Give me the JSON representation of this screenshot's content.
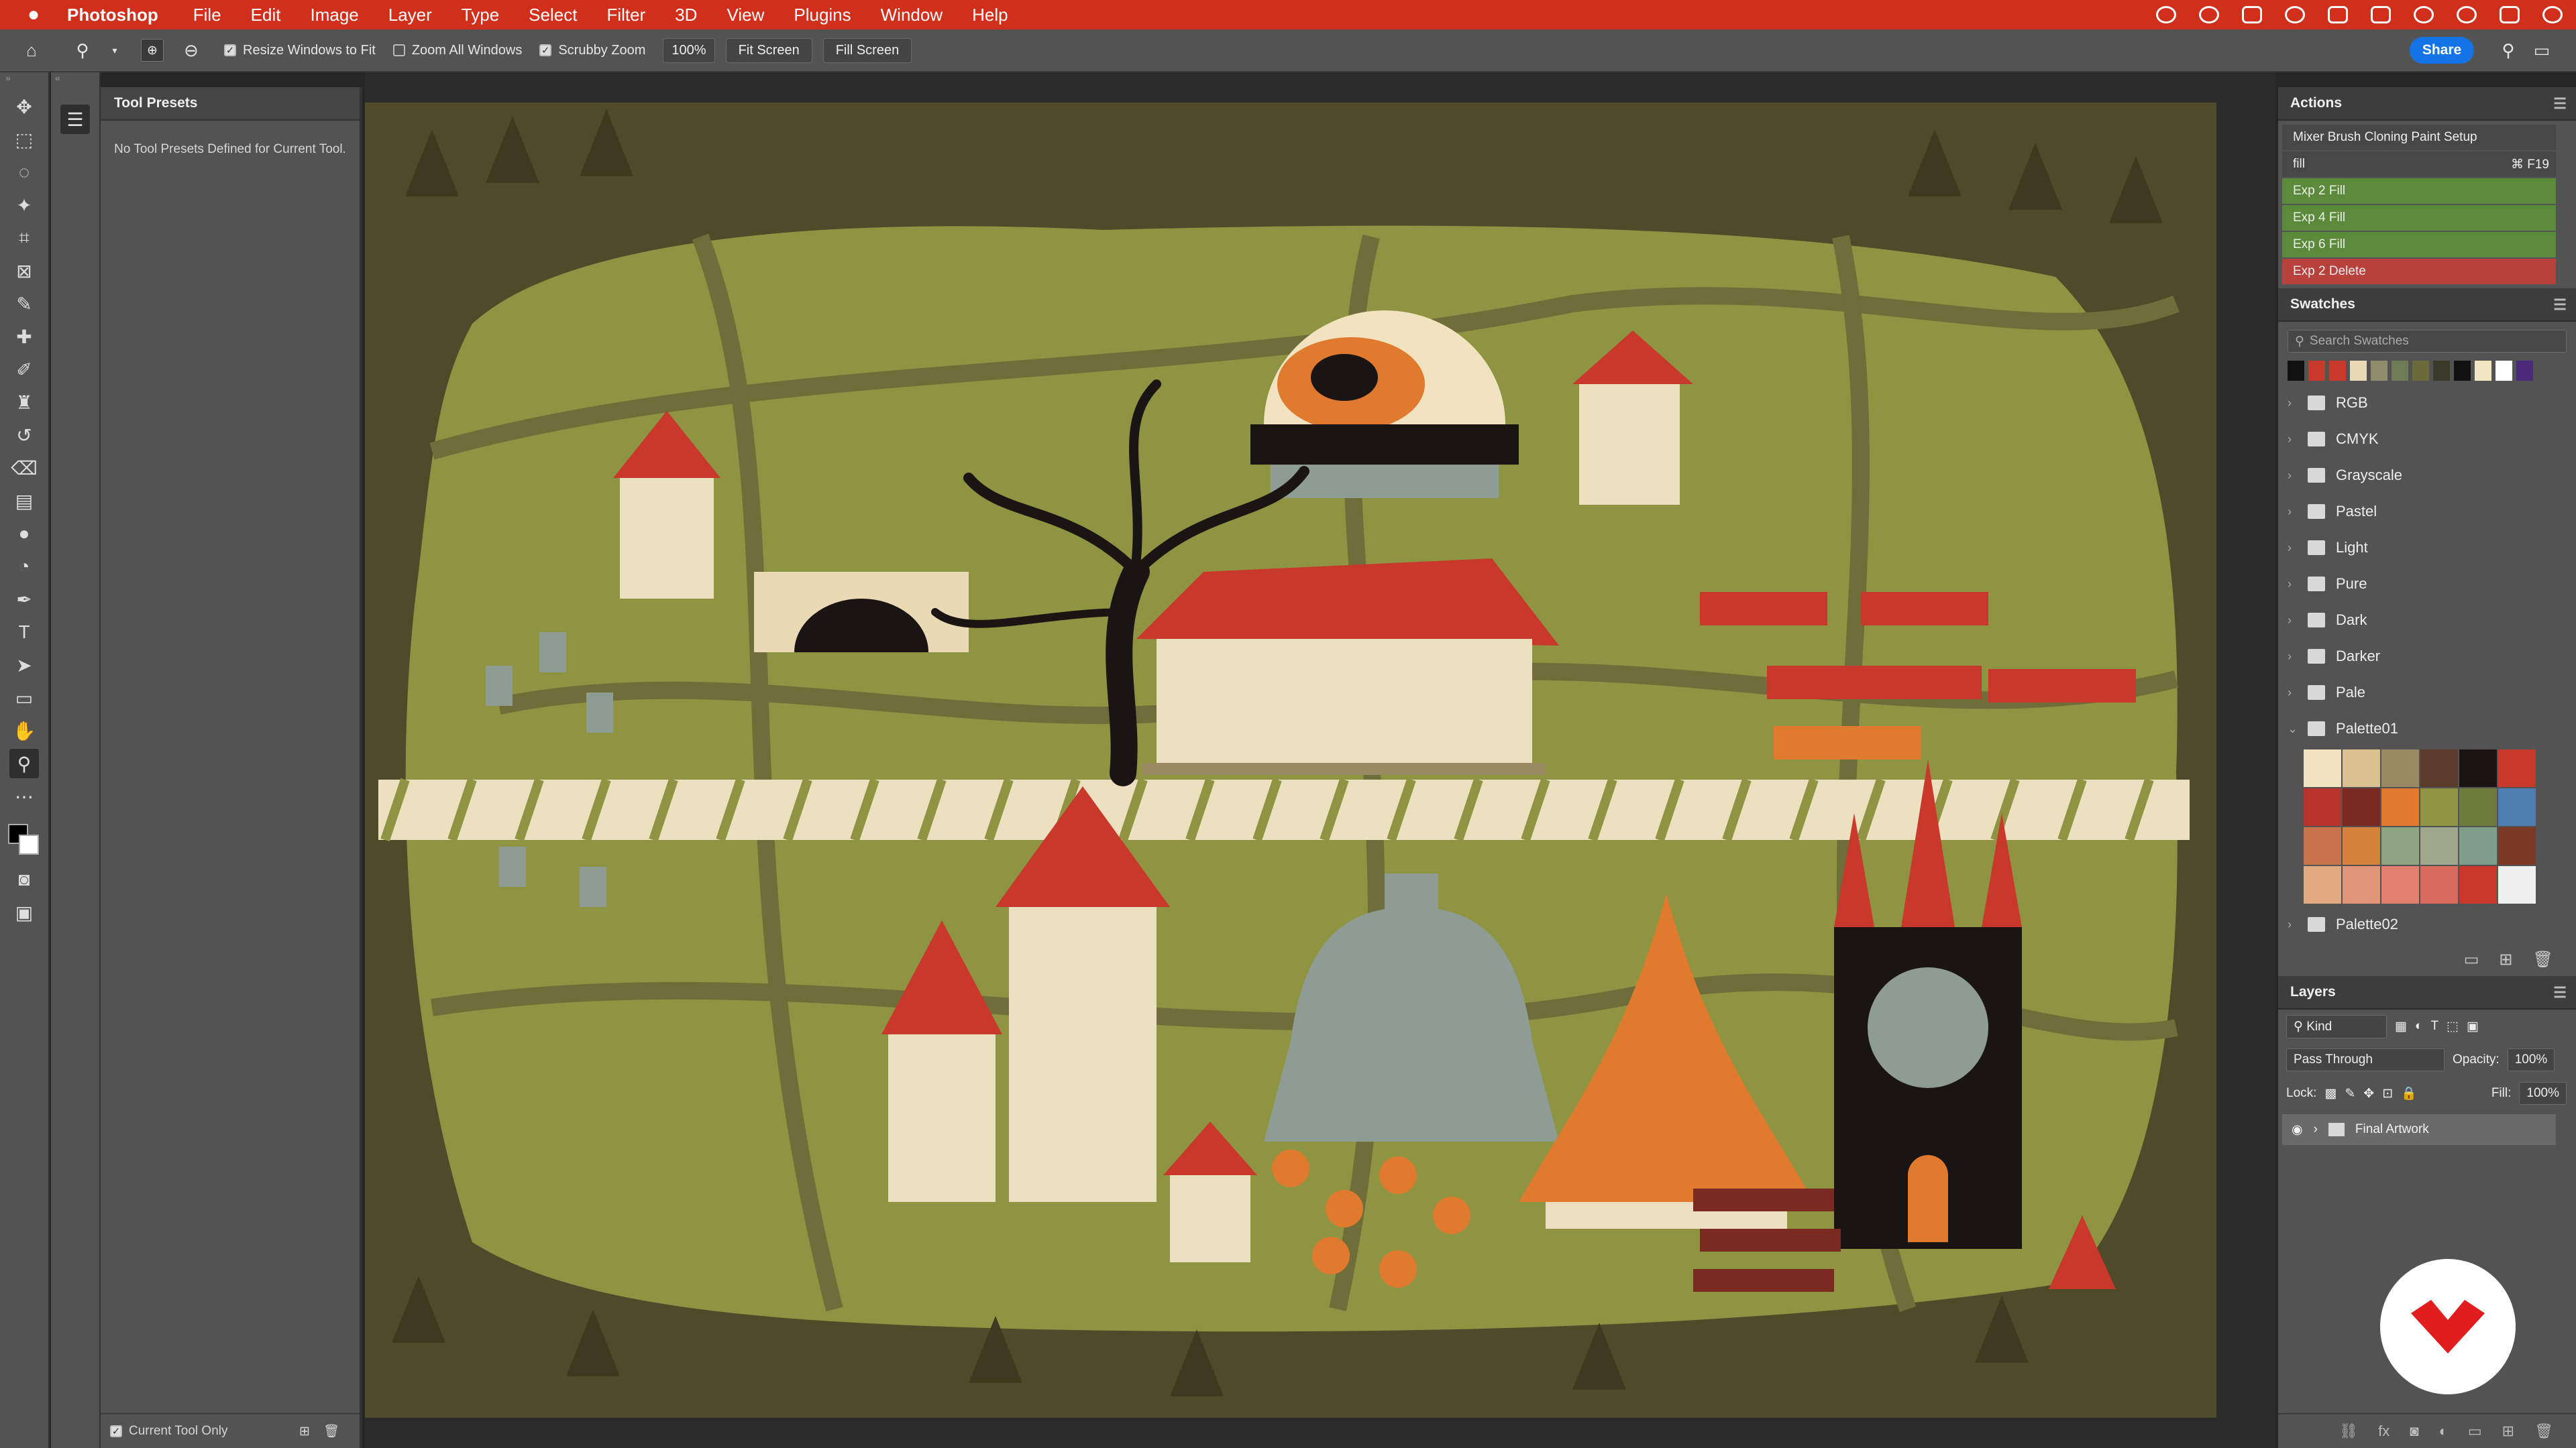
{
  "menubar": {
    "apple": "",
    "app_name": "Photoshop",
    "items": [
      "File",
      "Edit",
      "Image",
      "Layer",
      "Type",
      "Select",
      "Filter",
      "3D",
      "View",
      "Plugins",
      "Window",
      "Help"
    ]
  },
  "options": {
    "resize_windows": "Resize Windows to Fit",
    "zoom_all": "Zoom All Windows",
    "scrubby_zoom": "Scrubby Zoom",
    "zoom_value": "100%",
    "fit_screen": "Fit Screen",
    "fill_screen": "Fill Screen",
    "share": "Share"
  },
  "tool_presets": {
    "title": "Tool Presets",
    "empty_text": "No Tool Presets Defined for Current Tool.",
    "current_tool_only": "Current Tool Only"
  },
  "actions": {
    "title": "Actions",
    "items": [
      {
        "label": "Mixer Brush Cloning Paint Setup",
        "shortcut": ""
      },
      {
        "label": "fill",
        "shortcut": "⌘ F19"
      },
      {
        "label": "Exp 2 Fill",
        "shortcut": ""
      },
      {
        "label": "Exp 4 Fill",
        "shortcut": ""
      },
      {
        "label": "Exp 6 Fill",
        "shortcut": ""
      },
      {
        "label": "Exp 2 Delete",
        "shortcut": ""
      }
    ]
  },
  "swatches": {
    "title": "Swatches",
    "search_placeholder": "Search Swatches",
    "recent": [
      "#111111",
      "#c8392b",
      "#c8392b",
      "#e9d9b4",
      "#8e8c6a",
      "#6f7b58",
      "#6a6a3a",
      "#3a3a2a",
      "#111111",
      "#f1e6c4",
      "#ffffff",
      "#4b2a7a"
    ],
    "groups": [
      "RGB",
      "CMYK",
      "Grayscale",
      "Pastel",
      "Light",
      "Pure",
      "Dark",
      "Darker",
      "Pale",
      "Palette01",
      "Palette02"
    ],
    "palette01": [
      "#f1e3bf",
      "#d9c28f",
      "#9a8a63",
      "#5a3d2c",
      "#1a1412",
      "#c8392b",
      "#b8322a",
      "#7b2a22",
      "#e07a2e",
      "#8e9442",
      "#6f7b3a",
      "#4f7fb0",
      "#c9734a",
      "#d5813a",
      "#8fa582",
      "#a0a78c",
      "#7f9e8a",
      "#7a3a25",
      "#e3a980",
      "#e3957a",
      "#e08070",
      "#d86a5e",
      "#c8392b",
      "#f0f0f0"
    ]
  },
  "layers": {
    "title": "Layers",
    "kind": "Kind",
    "blend": "Pass Through",
    "opacity_label": "Opacity:",
    "opacity": "100%",
    "lock_label": "Lock:",
    "fill_label": "Fill:",
    "fill": "100%",
    "layer_name": "Final Artwork"
  },
  "colors": {
    "menubar": "#d0301b",
    "panel": "#535353",
    "canvas_bg": "#8e9442",
    "forest": "#4f4a2a",
    "path": "#6f6d3a",
    "red_roof": "#c8392b",
    "cream": "#ece0c0",
    "orange": "#e07a2e",
    "grey_stone": "#8e9c94"
  }
}
